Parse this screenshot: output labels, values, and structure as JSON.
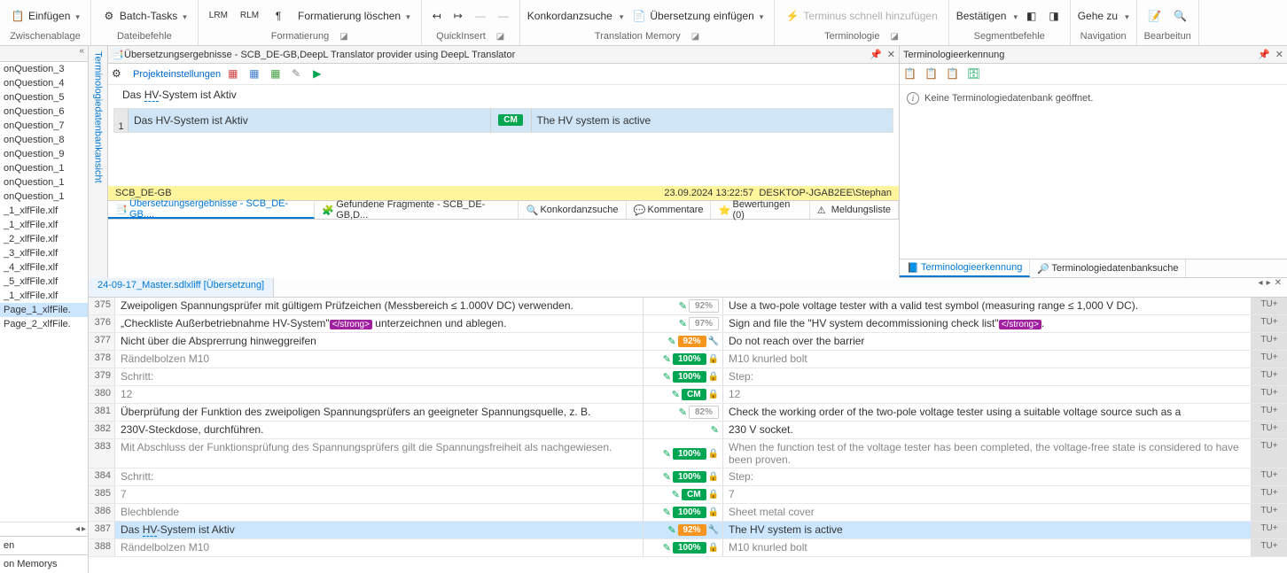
{
  "ribbon": {
    "einfuegen": "Einfügen",
    "zwischenablage": "Zwischenablage",
    "batch": "Batch-Tasks",
    "dateibefehle": "Dateibefehle",
    "lrm": "LRM",
    "rlm": "RLM",
    "format_loeschen": "Formatierung löschen",
    "formatierung": "Formatierung",
    "quickinsert": "QuickInsert",
    "konkordanz": "Konkordanzsuche",
    "uebersetzung_einfuegen": "Übersetzung einfügen",
    "translation_memory": "Translation Memory",
    "terminus": "Terminus schnell hinzufügen",
    "terminologie": "Terminologie",
    "bestaetigen": "Bestätigen",
    "segmentbefehle": "Segmentbefehle",
    "gehe_zu": "Gehe zu",
    "navigation": "Navigation",
    "bearbeitung": "Bearbeitun"
  },
  "left": {
    "items": [
      "onQuestion_3",
      "onQuestion_4",
      "onQuestion_5",
      "onQuestion_6",
      "onQuestion_7",
      "onQuestion_8",
      "onQuestion_9",
      "onQuestion_1",
      "onQuestion_1",
      "onQuestion_1",
      "_1_xlfFile.xlf",
      "_1_xlfFile.xlf",
      "_2_xlfFile.xlf",
      "_3_xlfFile.xlf",
      "_4_xlfFile.xlf",
      "_5_xlfFile.xlf",
      "_1_xlfFile.xlf",
      "Page_1_xlfFile.",
      "Page_2_xlfFile."
    ],
    "sel_index": 17,
    "footer1": "en",
    "footer2": "on Memorys"
  },
  "vtab": "Terminologiedatenbankansicht",
  "tm_panel": {
    "title": "Übersetzungsergebnisse - SCB_DE-GB,DeepL Translator provider using DeepL Translator",
    "proj_settings": "Projekteinstellungen",
    "context": "Das ",
    "context_hv": "HV",
    "context_rest": "-System ist Aktiv",
    "row_num": "1",
    "src": "Das HV-System ist Aktiv",
    "badge": "CM",
    "tgt": "The HV system is active",
    "provider": "SCB_DE-GB",
    "timestamp": "23.09.2024 13:22:57",
    "user": "DESKTOP-JGAB2EE\\Stephan"
  },
  "tabs": {
    "t1": "Übersetzungsergebnisse  -  SCB_DE-GB,...",
    "t2": "Gefundene Fragmente - SCB_DE-GB,D...",
    "t3": "Konkordanzsuche",
    "t4": "Kommentare",
    "t5": "Bewertungen (0)",
    "t6": "Meldungsliste"
  },
  "term_panel": {
    "title": "Terminologieerkennung",
    "msg": "Keine Terminologiedatenbank geöffnet.",
    "tab1": "Terminologieerkennung",
    "tab2": "Terminologiedatenbanksuche"
  },
  "doc_tab": "24-09-17_Master.sdlxliff [Übersetzung]",
  "tag_strong": "</strong>",
  "segments": [
    {
      "n": "375",
      "src": "Zweipoligen Spannungsprüfer mit gültigem Prüfzeichen (Messbereich ≤ 1.000V DC) verwenden.",
      "st": "92%",
      "cls": "pct-low",
      "tgt": "Use a two-pole voltage tester with a valid test symbol (measuring range ≤ 1,000 V DC).",
      "lock": false,
      "origin": "TU+"
    },
    {
      "n": "376",
      "src_pre": "„Checkliste Außerbetriebnahme HV-System\"",
      "src_post": " unterzeichnen und ablegen.",
      "st": "97%",
      "cls": "pct-low",
      "tgt_pre": "Sign and file the \"HV system decommissioning check list\"",
      "tgt_post": ".",
      "has_tag": true,
      "lock": false,
      "origin": "TU+"
    },
    {
      "n": "377",
      "src": "Nicht über die Absprerrung hinweggreifen",
      "st": "92%",
      "cls": "pct92",
      "wrench": true,
      "tgt": "Do not reach over the barrier",
      "lock": false,
      "origin": "TU+"
    },
    {
      "n": "378",
      "src": "Rändelbolzen M10",
      "st": "100%",
      "cls": "pct100",
      "tgt": "M10 knurled bolt",
      "lock": true,
      "origin": "TU+"
    },
    {
      "n": "379",
      "src": "Schritt:",
      "st": "100%",
      "cls": "pct100",
      "tgt": "Step:",
      "lock": true,
      "origin": "TU+"
    },
    {
      "n": "380",
      "src": "12",
      "st": "CM",
      "cls": "cm",
      "tgt": "12",
      "lock": true,
      "origin": "TU+"
    },
    {
      "n": "381",
      "src": "Überprüfung der Funktion des zweipoligen Spannungsprüfers an geeigneter Spannungsquelle, z. B.",
      "st": "82%",
      "cls": "pct-low",
      "tgt": "Check the working order of the two-pole voltage tester using a suitable voltage source such as a",
      "lock": false,
      "origin": "TU+"
    },
    {
      "n": "382",
      "src": "230V-Steckdose, durchführen.",
      "st": "",
      "cls": "",
      "tgt": " 230 V socket.",
      "lock": false,
      "origin": "TU+"
    },
    {
      "n": "383",
      "src": "Mit Abschluss der Funktionsprüfung des Spannungsprüfers gilt die Spannungsfreiheit als nachgewiesen.",
      "st": "100%",
      "cls": "pct100",
      "tgt": "When the function test of the voltage tester has been completed, the voltage-free state is considered to have been proven.",
      "lock": true,
      "origin": "TU+"
    },
    {
      "n": "384",
      "src": "Schritt:",
      "st": "100%",
      "cls": "pct100",
      "tgt": "Step:",
      "lock": true,
      "origin": "TU+"
    },
    {
      "n": "385",
      "src": "7",
      "st": "CM",
      "cls": "cm",
      "tgt": "7",
      "lock": true,
      "origin": "TU+"
    },
    {
      "n": "386",
      "src": "Blechblende",
      "st": "100%",
      "cls": "pct100",
      "tgt": "Sheet metal cover",
      "lock": true,
      "origin": "TU+"
    },
    {
      "n": "387",
      "src_pre": "Das ",
      "src_hv": "HV",
      "src_post": "-System ist Aktiv",
      "st": "92%",
      "cls": "pct92",
      "wrench": true,
      "tgt": "The HV system is active",
      "lock": false,
      "active": true,
      "origin": "TU+"
    },
    {
      "n": "388",
      "src": "Rändelbolzen M10",
      "st": "100%",
      "cls": "pct100",
      "tgt": "M10 knurled bolt",
      "lock": true,
      "origin": "TU+"
    }
  ]
}
